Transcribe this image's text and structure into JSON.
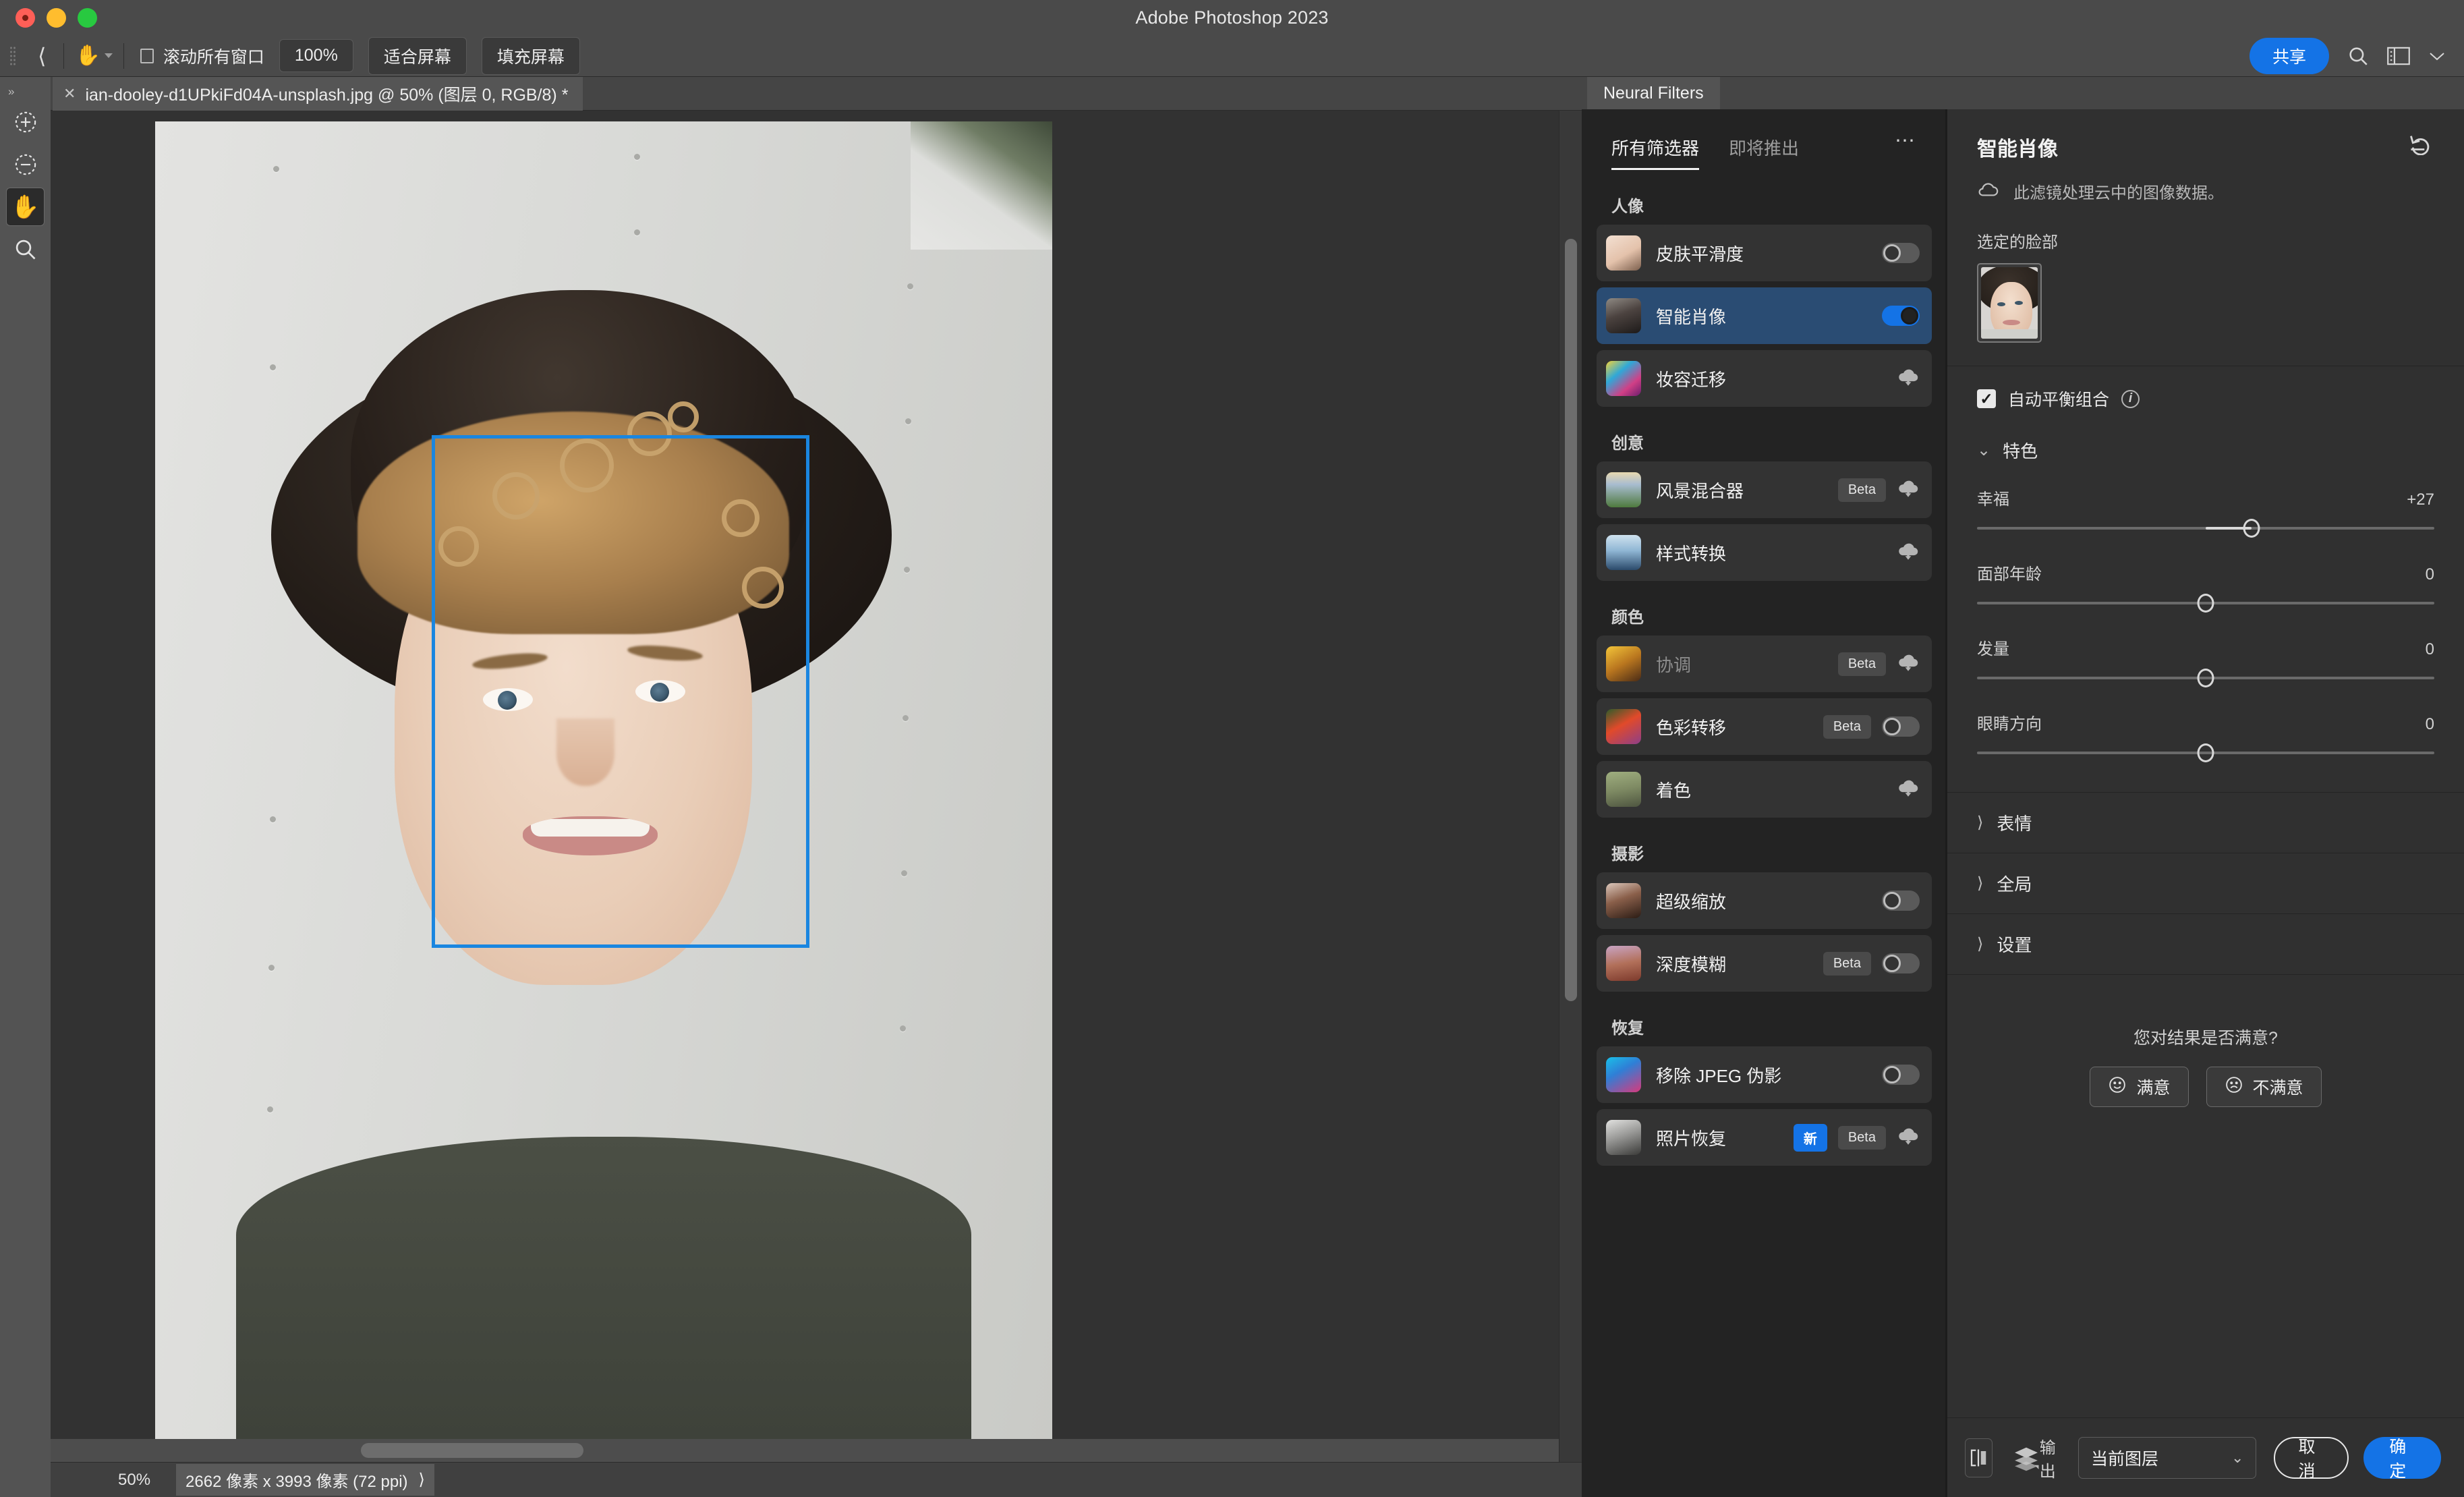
{
  "window": {
    "title": "Adobe Photoshop 2023"
  },
  "options_bar": {
    "back_icon": "back-chevron-icon",
    "tool_icon": "hand-tool-icon",
    "scroll_all_windows_label": "滚动所有窗口",
    "zoom_100_label": "100%",
    "fit_screen_label": "适合屏幕",
    "fill_screen_label": "填充屏幕",
    "share_label": "共享",
    "search_icon": "search-icon",
    "workspace_icon": "workspace-layout-icon",
    "chevron_icon": "chevron-down-icon"
  },
  "toolstrip": {
    "items": [
      {
        "icon": "zoom-in-marquee-icon",
        "active": false
      },
      {
        "icon": "zoom-out-marquee-icon",
        "active": false
      },
      {
        "icon": "hand-tool-icon",
        "active": true
      },
      {
        "icon": "magnifier-icon",
        "active": false
      }
    ]
  },
  "document": {
    "tab_title": "ian-dooley-d1UPkiFd04A-unsplash.jpg @ 50% (图层 0, RGB/8) *",
    "close_icon": "close-icon"
  },
  "statusbar": {
    "zoom": "50%",
    "dimensions": "2662 像素 x 3993 像素 (72 ppi)",
    "expand_icon": "chevron-right-icon"
  },
  "neural_filters": {
    "panel_tab": "Neural Filters",
    "list": {
      "tabs": [
        {
          "label": "所有筛选器",
          "active": true
        },
        {
          "label": "即将推出",
          "active": false
        }
      ],
      "overflow_icon": "more-options-icon",
      "groups": [
        {
          "title": "人像",
          "items": [
            {
              "name": "皮肤平滑度",
              "thumb": "skin-smoothing-thumb",
              "badges": [],
              "control": "toggle",
              "toggle_on": false,
              "selected": false,
              "dim": false
            },
            {
              "name": "智能肖像",
              "thumb": "smart-portrait-thumb",
              "badges": [],
              "control": "toggle",
              "toggle_on": true,
              "selected": true,
              "dim": false
            },
            {
              "name": "妆容迁移",
              "thumb": "makeup-transfer-thumb",
              "badges": [],
              "control": "download",
              "toggle_on": false,
              "selected": false,
              "dim": false
            }
          ]
        },
        {
          "title": "创意",
          "items": [
            {
              "name": "风景混合器",
              "thumb": "landscape-mixer-thumb",
              "badges": [
                "Beta"
              ],
              "control": "download",
              "toggle_on": false,
              "selected": false,
              "dim": false
            },
            {
              "name": "样式转换",
              "thumb": "style-transfer-thumb",
              "badges": [],
              "control": "download",
              "toggle_on": false,
              "selected": false,
              "dim": false
            }
          ]
        },
        {
          "title": "颜色",
          "items": [
            {
              "name": "协调",
              "thumb": "harmonization-thumb",
              "badges": [
                "Beta"
              ],
              "control": "download",
              "toggle_on": false,
              "selected": false,
              "dim": true
            },
            {
              "name": "色彩转移",
              "thumb": "color-transfer-thumb",
              "badges": [
                "Beta"
              ],
              "control": "toggle",
              "toggle_on": false,
              "selected": false,
              "dim": false
            },
            {
              "name": "着色",
              "thumb": "colorize-thumb",
              "badges": [],
              "control": "download",
              "toggle_on": false,
              "selected": false,
              "dim": false
            }
          ]
        },
        {
          "title": "摄影",
          "items": [
            {
              "name": "超级缩放",
              "thumb": "super-zoom-thumb",
              "badges": [],
              "control": "toggle",
              "toggle_on": false,
              "selected": false,
              "dim": false
            },
            {
              "name": "深度模糊",
              "thumb": "depth-blur-thumb",
              "badges": [
                "Beta"
              ],
              "control": "toggle",
              "toggle_on": false,
              "selected": false,
              "dim": false
            }
          ]
        },
        {
          "title": "恢复",
          "items": [
            {
              "name": "移除 JPEG 伪影",
              "thumb": "jpeg-artifacts-thumb",
              "badges": [],
              "control": "toggle",
              "toggle_on": false,
              "selected": false,
              "dim": false
            },
            {
              "name": "照片恢复",
              "thumb": "photo-restoration-thumb",
              "badges": [
                "新",
                "Beta"
              ],
              "control": "download",
              "toggle_on": false,
              "selected": false,
              "dim": false
            }
          ]
        }
      ]
    },
    "detail": {
      "title": "智能肖像",
      "reset_icon": "reset-icon",
      "cloud_icon": "cloud-icon",
      "cloud_note": "此滤镜处理云中的图像数据。",
      "selected_face_label": "选定的脸部",
      "face_thumb": "selected-face-thumb",
      "auto_balance": {
        "label": "自动平衡组合",
        "checked": true,
        "info_icon": "info-icon"
      },
      "sections": [
        {
          "label": "特色",
          "expanded": true,
          "sliders": [
            {
              "label": "幸福",
              "value": "+27",
              "pos": 60,
              "fill_from": 50
            },
            {
              "label": "面部年龄",
              "value": "0",
              "pos": 50,
              "fill_from": 50
            },
            {
              "label": "发量",
              "value": "0",
              "pos": 50,
              "fill_from": 50
            },
            {
              "label": "眼睛方向",
              "value": "0",
              "pos": 50,
              "fill_from": 50
            }
          ]
        }
      ],
      "collapsed_sections": [
        {
          "label": "表情",
          "expanded": false
        },
        {
          "label": "全局",
          "expanded": false
        },
        {
          "label": "设置",
          "expanded": false
        }
      ],
      "feedback": {
        "question": "您对结果是否满意?",
        "positive_label": "满意",
        "positive_icon": "smiley-happy-icon",
        "negative_label": "不满意",
        "negative_icon": "smiley-sad-icon"
      }
    },
    "footer": {
      "preview_icon": "split-preview-icon",
      "layers_icon": "layers-icon",
      "output_label": "输出",
      "output_value": "当前图层",
      "output_caret_icon": "chevron-down-icon",
      "cancel_label": "取消",
      "ok_label": "确定"
    }
  },
  "colors": {
    "accent": "#1473e6",
    "selection_row": "#2a4c73",
    "face_box": "#1a86e0",
    "panel_bg": "#303030",
    "list_bg": "#232323",
    "chrome": "#4a4a4a"
  }
}
